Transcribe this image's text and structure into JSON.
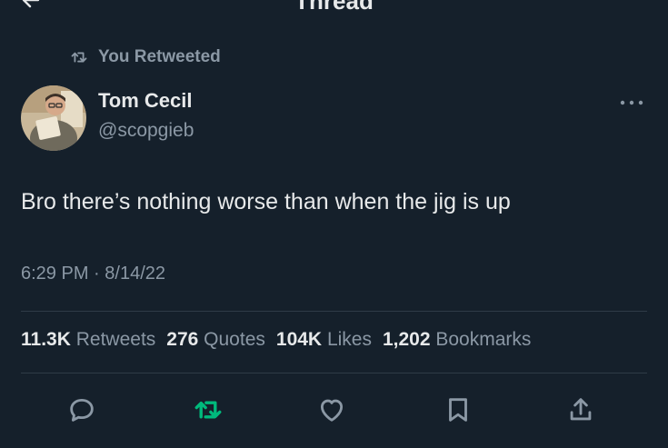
{
  "header": {
    "title": "Thread"
  },
  "retweet_notice": {
    "label": "You Retweeted"
  },
  "author": {
    "name": "Tom Cecil",
    "handle": "@scopgieb"
  },
  "tweet": {
    "text": "Bro there’s nothing worse than when the jig is up",
    "time": "6:29 PM",
    "sep": "·",
    "date": "8/14/22"
  },
  "stats": {
    "retweets_count": "11.3K",
    "retweets_label": "Retweets",
    "quotes_count": "276",
    "quotes_label": "Quotes",
    "likes_count": "104K",
    "likes_label": "Likes",
    "bookmarks_count": "1,202",
    "bookmarks_label": "Bookmarks"
  },
  "actions": [
    {
      "icon": "reply-icon"
    },
    {
      "icon": "retweet-icon",
      "active": true
    },
    {
      "icon": "like-icon"
    },
    {
      "icon": "bookmark-icon"
    },
    {
      "icon": "share-icon"
    }
  ],
  "colors": {
    "background": "#15202b",
    "primary_text": "#e7e9ea",
    "secondary_text": "#8b98a5",
    "retweet_green": "#00ba7c"
  }
}
